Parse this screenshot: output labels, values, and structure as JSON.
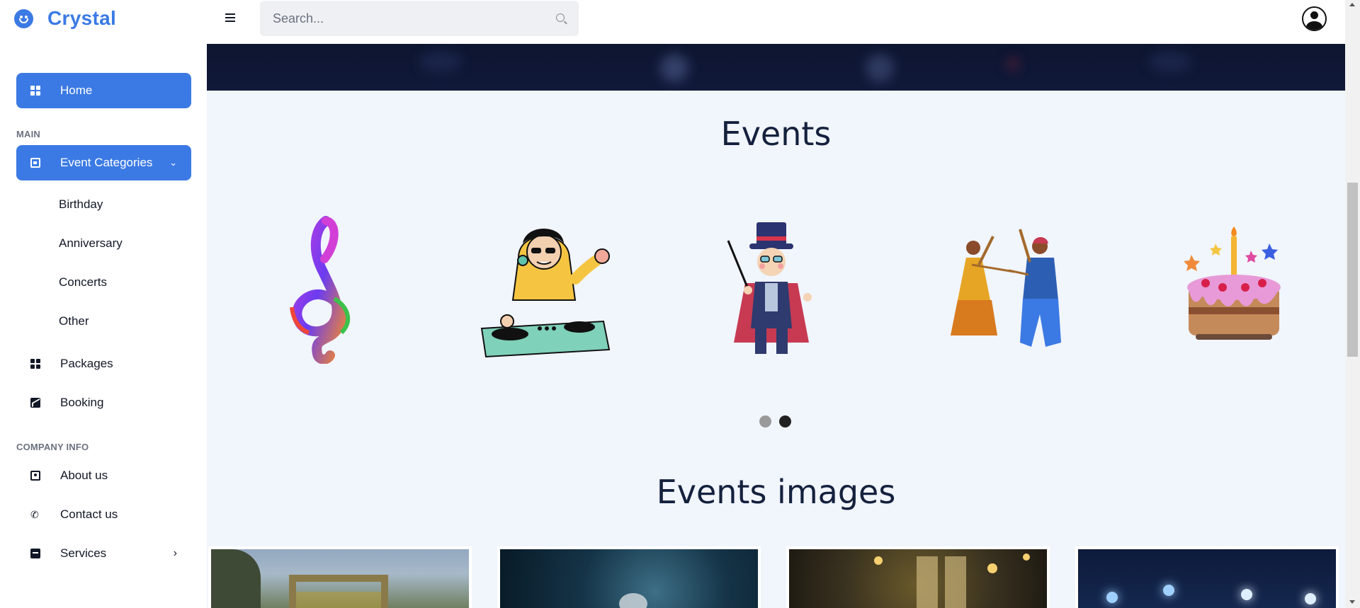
{
  "brand": {
    "name": "Crystal",
    "icon": "smiley-icon"
  },
  "search": {
    "placeholder": "Search..."
  },
  "sidebar": {
    "home": "Home",
    "main_section": "MAIN",
    "event_categories": "Event Categories",
    "sub_items": [
      "Birthday",
      "Anniversary",
      "Concerts",
      "Other"
    ],
    "packages": "Packages",
    "booking": "Booking",
    "company_section": "COMPANY INFO",
    "about": "About us",
    "contact": "Contact us",
    "services": "Services"
  },
  "main": {
    "events_title": "Events",
    "events_images_title": "Events images",
    "carousel_items": [
      "treble-clef-icon",
      "dj-illustration",
      "magician-illustration",
      "dandiya-dancers-illustration",
      "birthday-cake-illustration"
    ],
    "carousel_dots": 2,
    "carousel_active_dot": 2
  },
  "colors": {
    "accent": "#3b7ae4",
    "main_bg": "#f1f5fc",
    "title": "#14213d"
  }
}
